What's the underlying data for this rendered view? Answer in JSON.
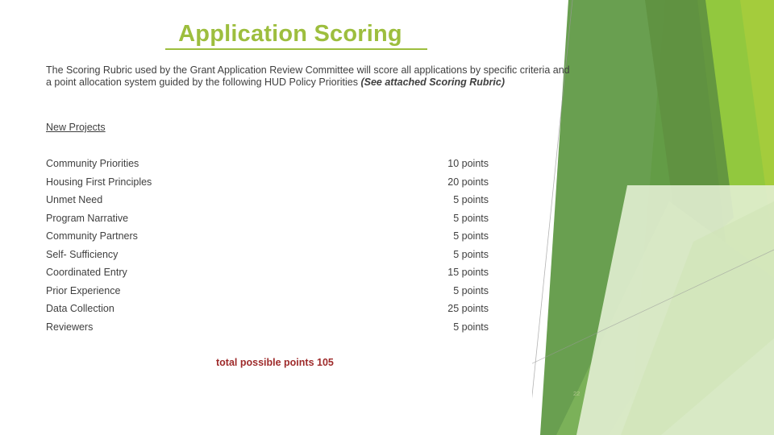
{
  "slide": {
    "title": "Application Scoring",
    "intro_part1": "The Scoring Rubric used by the Grant Application Review Committee will score all applications by specific criteria and a point allocation system guided by the following HUD Policy Priorities ",
    "intro_emphasis": "(See attached Scoring Rubric)",
    "section_heading": "New Projects",
    "total_line": "total possible points 105",
    "page_number": "22"
  },
  "scoring_rows": [
    {
      "label": "Community Priorities",
      "points": "10 points"
    },
    {
      "label": "Housing First Principles",
      "points": "20 points"
    },
    {
      "label": "Unmet Need",
      "points": "5 points"
    },
    {
      "label": "Program Narrative",
      "points": "5 points"
    },
    {
      "label": "Community Partners",
      "points": "5 points"
    },
    {
      "label": "Self- Sufficiency",
      "points": "5 points"
    },
    {
      "label": "Coordinated Entry",
      "points": "15 points"
    },
    {
      "label": "Prior Experience",
      "points": "5 points"
    },
    {
      "label": "Data Collection",
      "points": "25 points"
    },
    {
      "label": "Reviewers",
      "points": "5 points"
    }
  ],
  "colors": {
    "title_green": "#9dbe3e",
    "body_text": "#3f3f3f",
    "total_red": "#9e2b2b",
    "page_number": "#b3c98e",
    "deco_pale_green": "#e2eed2",
    "deco_light_green": "#cfe3b4",
    "deco_medium_green": "#7cb25a",
    "deco_muted_green": "#619a47",
    "deco_dark_green": "#5f9140",
    "deco_bright_green": "#92c83e",
    "deco_lime_green": "#a4cc3c",
    "deco_line_gray": "#9a9a9a"
  }
}
